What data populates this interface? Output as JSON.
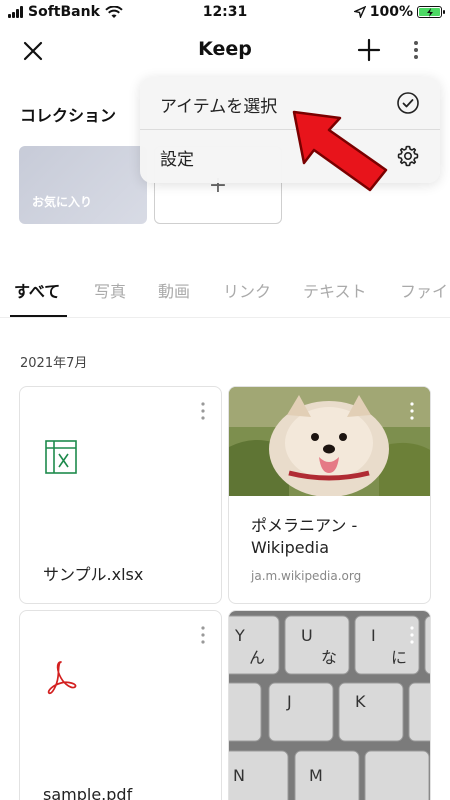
{
  "status": {
    "carrier": "SoftBank",
    "time": "12:31",
    "battery": "100%"
  },
  "header": {
    "title": "Keep"
  },
  "collection": {
    "title": "コレクション",
    "favorite_label": "お気に入り",
    "add_label": "+"
  },
  "menu": {
    "items": [
      {
        "label": "アイテムを選択",
        "icon": "check-circle-icon"
      },
      {
        "label": "設定",
        "icon": "gear-icon"
      }
    ]
  },
  "tabs": [
    "すべて",
    "写真",
    "動画",
    "リンク",
    "テキスト",
    "ファイ"
  ],
  "active_tab": "すべて",
  "date_label": "2021年7月",
  "cards": [
    {
      "type": "file",
      "icon": "excel-icon",
      "name": "サンプル.xlsx"
    },
    {
      "type": "link",
      "title": "ポメラニアン - Wikipedia",
      "url": "ja.m.wikipedia.org",
      "image": "pomeranian-photo"
    },
    {
      "type": "file",
      "icon": "pdf-icon",
      "name": "sample.pdf"
    },
    {
      "type": "photo",
      "image": "keyboard-photo"
    }
  ],
  "colors": {
    "excel": "#1e8a4c",
    "pdf": "#d32020",
    "arrow": "#e8141b",
    "battery": "#4cd964"
  }
}
